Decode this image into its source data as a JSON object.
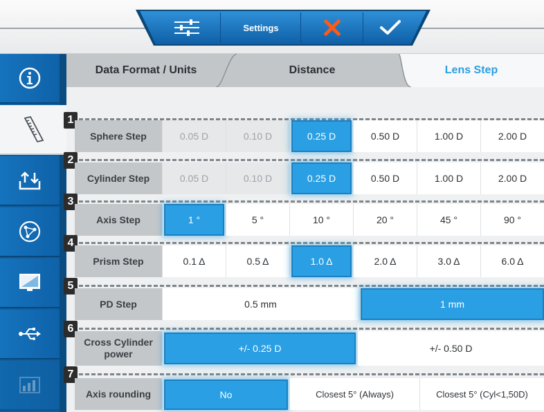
{
  "toolbar": {
    "title": "Settings",
    "filter_icon": "sliders-icon",
    "cancel_icon": "close-x-icon",
    "confirm_icon": "checkmark-icon",
    "cancel_color": "#ff5a14"
  },
  "sidebar": {
    "items": [
      {
        "icon": "info-icon",
        "active": false
      },
      {
        "icon": "ruler-icon",
        "active": true
      },
      {
        "icon": "tray-import-icon",
        "active": false
      },
      {
        "icon": "network-circle-icon",
        "active": false
      },
      {
        "icon": "monitor-icon",
        "active": false
      },
      {
        "icon": "usb-icon",
        "active": false
      },
      {
        "icon": "chart-icon",
        "active": false,
        "disabled": true
      }
    ]
  },
  "tabs": [
    {
      "label": "Data Format / Units",
      "active": false
    },
    {
      "label": "Distance",
      "active": false
    },
    {
      "label": "Lens Step",
      "active": true
    }
  ],
  "colors": {
    "selected": "#2a9fe3",
    "sidebar": "#0f5f9f",
    "active_tab_text": "#2a9fe3"
  },
  "rows": [
    {
      "number": "1",
      "label": "Sphere Step",
      "options": [
        {
          "text": "0.05 D",
          "state": "disabled"
        },
        {
          "text": "0.10 D",
          "state": "disabled"
        },
        {
          "text": "0.25 D",
          "state": "selected"
        },
        {
          "text": "0.50 D",
          "state": "normal"
        },
        {
          "text": "1.00 D",
          "state": "normal"
        },
        {
          "text": "2.00 D",
          "state": "normal"
        }
      ]
    },
    {
      "number": "2",
      "label": "Cylinder Step",
      "options": [
        {
          "text": "0.05 D",
          "state": "disabled"
        },
        {
          "text": "0.10 D",
          "state": "disabled"
        },
        {
          "text": "0.25 D",
          "state": "selected"
        },
        {
          "text": "0.50 D",
          "state": "normal"
        },
        {
          "text": "1.00 D",
          "state": "normal"
        },
        {
          "text": "2.00 D",
          "state": "normal"
        }
      ]
    },
    {
      "number": "3",
      "label": "Axis Step",
      "options": [
        {
          "text": "1 °",
          "state": "selected"
        },
        {
          "text": "5 °",
          "state": "normal"
        },
        {
          "text": "10 °",
          "state": "normal"
        },
        {
          "text": "20 °",
          "state": "normal"
        },
        {
          "text": "45 °",
          "state": "normal"
        },
        {
          "text": "90 °",
          "state": "normal"
        }
      ]
    },
    {
      "number": "4",
      "label": "Prism Step",
      "options": [
        {
          "text": "0.1 Δ",
          "state": "normal"
        },
        {
          "text": "0.5 Δ",
          "state": "normal"
        },
        {
          "text": "1.0 Δ",
          "state": "selected"
        },
        {
          "text": "2.0 Δ",
          "state": "normal"
        },
        {
          "text": "3.0 Δ",
          "state": "normal"
        },
        {
          "text": "6.0 Δ",
          "state": "normal"
        }
      ]
    },
    {
      "number": "5",
      "label": "PD Step",
      "options": [
        {
          "text": "0.5 mm",
          "state": "normal"
        },
        {
          "text": "1 mm",
          "state": "selected"
        }
      ]
    },
    {
      "number": "6",
      "label": "Cross Cylinder power",
      "options": [
        {
          "text": "+/- 0.25 D",
          "state": "selected"
        },
        {
          "text": "+/- 0.50 D",
          "state": "normal"
        }
      ]
    },
    {
      "number": "7",
      "label": "Axis rounding",
      "options": [
        {
          "text": "No",
          "state": "selected"
        },
        {
          "text": "Closest 5° (Always)",
          "state": "normal"
        },
        {
          "text": "Closest 5° (Cyl<1,50D)",
          "state": "normal"
        }
      ]
    }
  ]
}
